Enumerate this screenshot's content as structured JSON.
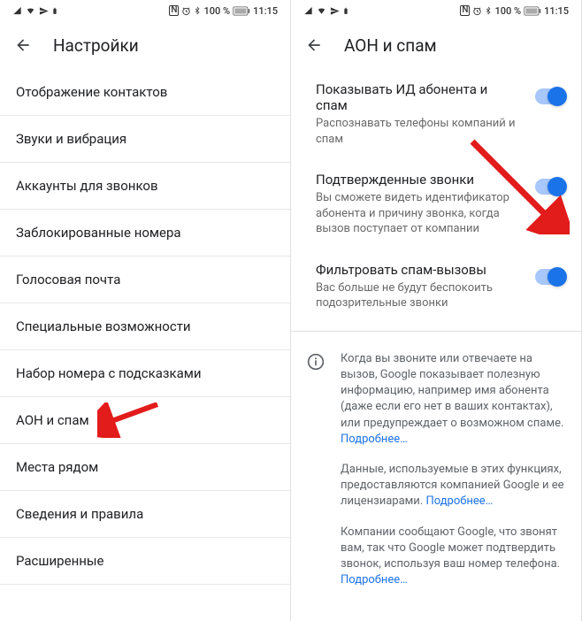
{
  "status": {
    "left_icons": "📶 ✈ 🔔",
    "right_icons": "ℕ ⏰ ✱",
    "battery": "100 %",
    "time": "11:15"
  },
  "left": {
    "title": "Настройки",
    "items": [
      "Отображение контактов",
      "Звуки и вибрация",
      "Аккаунты для звонков",
      "Заблокированные номера",
      "Голосовая почта",
      "Специальные возможности",
      "Набор номера с подсказками",
      "АОН и спам",
      "Места рядом",
      "Сведения и правила",
      "Расширенные"
    ]
  },
  "right": {
    "title": "АОН и спам",
    "settings": [
      {
        "title": "Показывать ИД абонента и спам",
        "sub": "Распознавать телефоны компаний и спам"
      },
      {
        "title": "Подтвержденные звонки",
        "sub": "Вы сможете видеть идентификатор абонента и причину звонка, когда вызов поступает от компании"
      },
      {
        "title": "Фильтровать спам-вызовы",
        "sub": "Вас больше не будут беспокоить подозрительные звонки"
      }
    ],
    "info": [
      "Когда вы звоните или отвечаете на вызов, Google показывает полезную информацию, например имя абонента (даже если его нет в ваших контактах), или предупреждает о возможном спаме.",
      "Данные, используемые в этих функциях, предоставляются компанией Google и ее лицензиарами.",
      "Компании сообщают Google, что звонят вам, так что Google может подтвердить звонок, используя ваш номер телефона."
    ],
    "more": "Подробнее…"
  }
}
